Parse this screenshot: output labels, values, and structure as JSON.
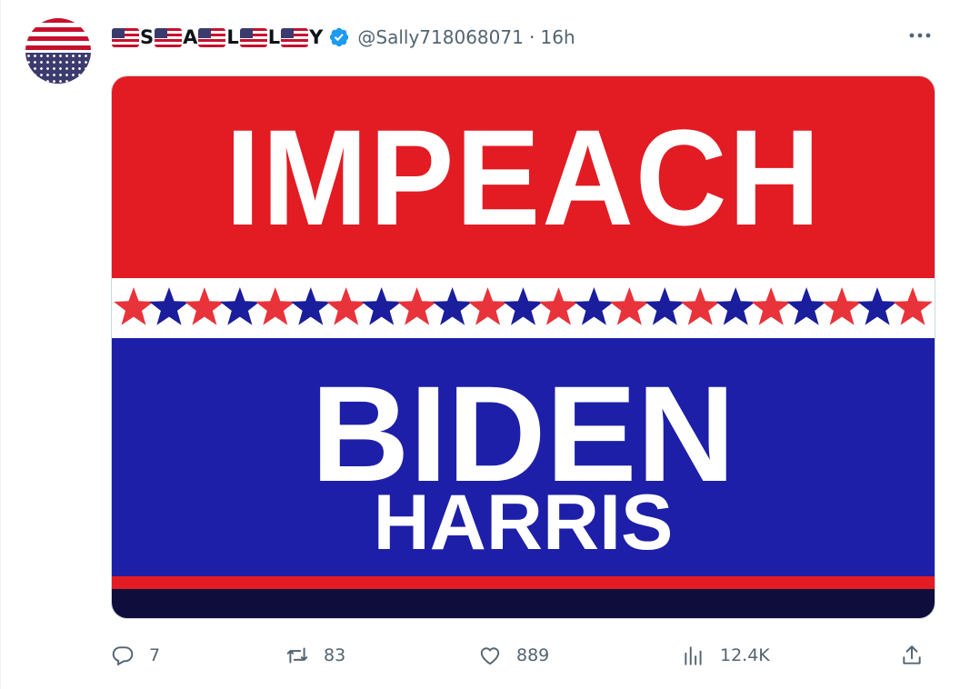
{
  "tweet": {
    "display_name_letters": [
      "S",
      "A",
      "L",
      "L",
      "Y"
    ],
    "handle": "@Sally718068071",
    "separator": "·",
    "time": "16h",
    "image": {
      "line1": "IMPEACH",
      "line2": "BIDEN",
      "line3": "HARRIS"
    },
    "actions": {
      "replies": "7",
      "retweets": "83",
      "likes": "889",
      "views": "12.4K"
    }
  },
  "icons": {
    "verified": "verified-badge-icon",
    "more": "more-options-icon",
    "reply": "reply-icon",
    "retweet": "retweet-icon",
    "like": "heart-icon",
    "views": "views-icon",
    "share": "share-icon"
  },
  "colors": {
    "banner_red": "#e31b23",
    "banner_blue": "#1d1fa8",
    "navy": "#0e0d3b",
    "verified_blue": "#1d9bf0",
    "muted": "#536471"
  }
}
